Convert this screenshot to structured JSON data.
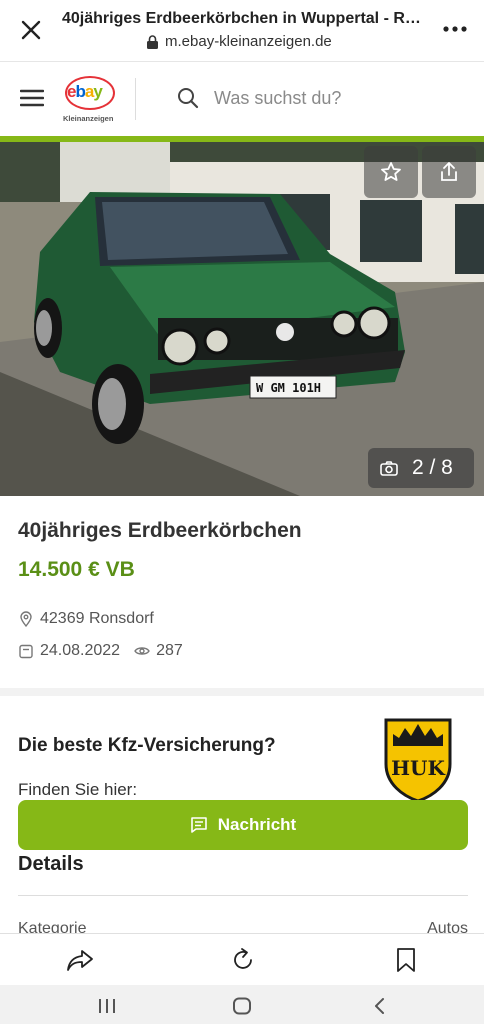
{
  "browser": {
    "title": "40jähriges Erdbeerkörbchen in Wuppertal - Ro...",
    "url": "m.ebay-kleinanzeigen.de"
  },
  "site": {
    "logo_text": "ebay",
    "logo_sub": "Kleinanzeigen",
    "search_placeholder": "Was suchst du?",
    "accent": "#86b817"
  },
  "gallery": {
    "counter": "2 / 8",
    "plate": "W GM 101H"
  },
  "listing": {
    "title": "40jähriges Erdbeerkörbchen",
    "price": "14.500 € VB",
    "location": "42369 Ronsdorf",
    "date": "24.08.2022",
    "views": "287"
  },
  "ad": {
    "title": "Die beste Kfz-Versicherung?",
    "subtitle": "Finden Sie hier:",
    "brand": "HUK"
  },
  "message_button": "Nachricht",
  "details": {
    "title": "Details",
    "rows": [
      {
        "label": "Kategorie",
        "value": "Autos"
      }
    ]
  }
}
